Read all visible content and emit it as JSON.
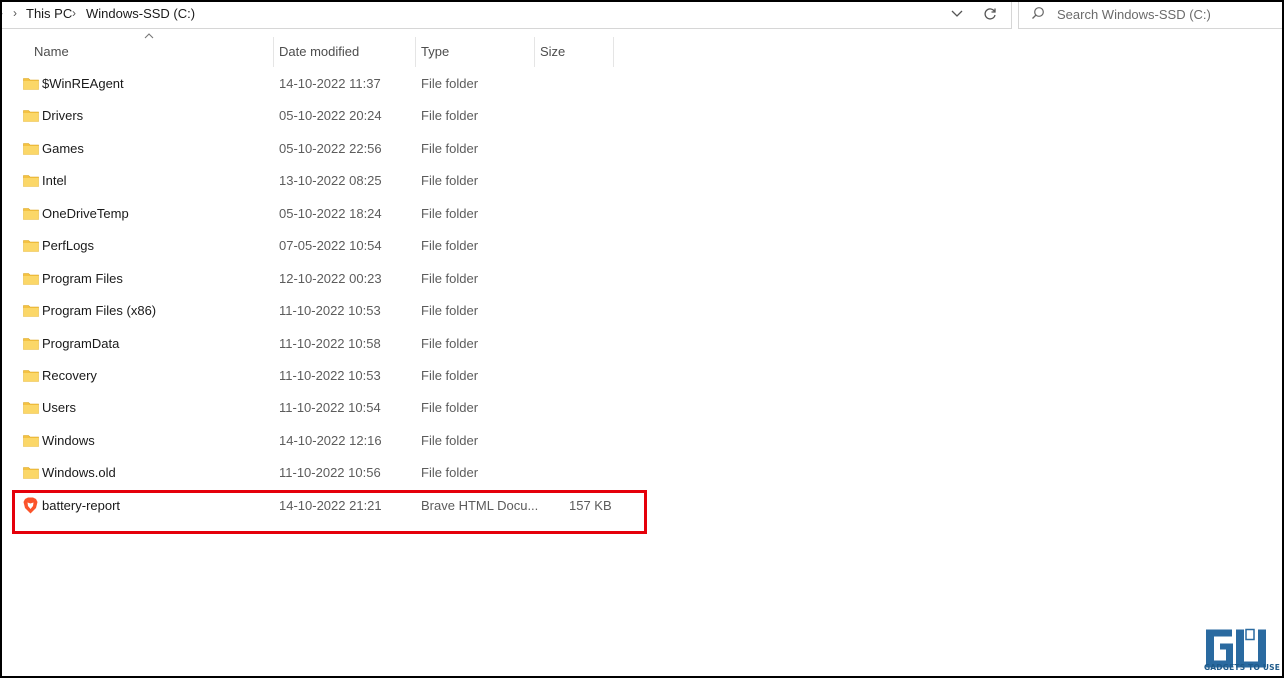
{
  "breadcrumb": {
    "items": [
      "This PC",
      "Windows-SSD (C:)"
    ]
  },
  "search": {
    "placeholder": "Search Windows-SSD (C:)"
  },
  "columns": {
    "name": "Name",
    "date_modified": "Date modified",
    "type": "Type",
    "size": "Size"
  },
  "files": [
    {
      "name": "$WinREAgent",
      "date": "14-10-2022 11:37",
      "type": "File folder",
      "size": "",
      "icon": "folder-icon"
    },
    {
      "name": "Drivers",
      "date": "05-10-2022 20:24",
      "type": "File folder",
      "size": "",
      "icon": "folder-icon"
    },
    {
      "name": "Games",
      "date": "05-10-2022 22:56",
      "type": "File folder",
      "size": "",
      "icon": "folder-icon"
    },
    {
      "name": "Intel",
      "date": "13-10-2022 08:25",
      "type": "File folder",
      "size": "",
      "icon": "folder-icon"
    },
    {
      "name": "OneDriveTemp",
      "date": "05-10-2022 18:24",
      "type": "File folder",
      "size": "",
      "icon": "folder-icon"
    },
    {
      "name": "PerfLogs",
      "date": "07-05-2022 10:54",
      "type": "File folder",
      "size": "",
      "icon": "folder-icon"
    },
    {
      "name": "Program Files",
      "date": "12-10-2022 00:23",
      "type": "File folder",
      "size": "",
      "icon": "folder-icon"
    },
    {
      "name": "Program Files (x86)",
      "date": "11-10-2022 10:53",
      "type": "File folder",
      "size": "",
      "icon": "folder-icon"
    },
    {
      "name": "ProgramData",
      "date": "11-10-2022 10:58",
      "type": "File folder",
      "size": "",
      "icon": "folder-icon"
    },
    {
      "name": "Recovery",
      "date": "11-10-2022 10:53",
      "type": "File folder",
      "size": "",
      "icon": "folder-icon"
    },
    {
      "name": "Users",
      "date": "11-10-2022 10:54",
      "type": "File folder",
      "size": "",
      "icon": "folder-icon"
    },
    {
      "name": "Windows",
      "date": "14-10-2022 12:16",
      "type": "File folder",
      "size": "",
      "icon": "folder-icon"
    },
    {
      "name": "Windows.old",
      "date": "11-10-2022 10:56",
      "type": "File folder",
      "size": "",
      "icon": "folder-icon"
    },
    {
      "name": "battery-report",
      "date": "14-10-2022 21:21",
      "type": "Brave HTML Docu...",
      "size": "157 KB",
      "icon": "brave-browser-icon"
    }
  ],
  "colors": {
    "highlight": "#e5000a",
    "folder": "#f5c242",
    "watermark": "#1e5a8a"
  },
  "watermark": {
    "text": "GADGETS TO USE"
  }
}
